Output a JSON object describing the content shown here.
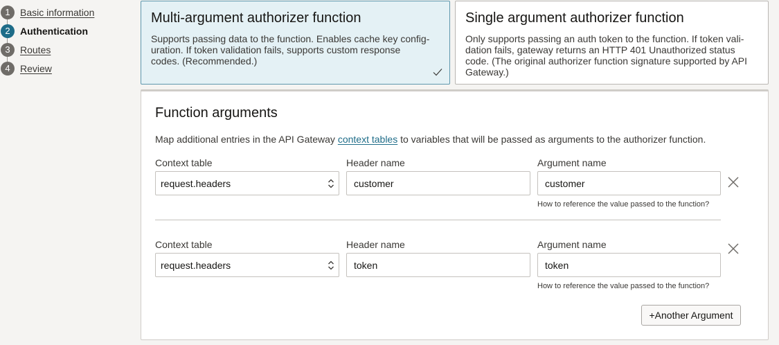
{
  "stepper": {
    "steps": [
      {
        "number": "1",
        "label": "Basic information",
        "active": false
      },
      {
        "number": "2",
        "label": "Authentication",
        "active": true
      },
      {
        "number": "3",
        "label": "Routes",
        "active": false
      },
      {
        "number": "4",
        "label": "Review",
        "active": false
      }
    ]
  },
  "cards": {
    "multi": {
      "title": "Multi-argument authorizer function",
      "desc_lines": [
        "Supports passing data to the function. Enables cache key config-",
        "uration. If token validation fails, supports custom response",
        "codes. (Recommended.)"
      ],
      "selected": true
    },
    "single": {
      "title": "Single argument authorizer function",
      "desc_lines": [
        "Only supports passing an auth token to the function. If token vali-",
        "dation fails, gateway returns an HTTP 401 Unauthorized status",
        "code. (The original authorizer function signature supported by API",
        "Gateway.)"
      ],
      "selected": false
    }
  },
  "function_arguments": {
    "title": "Function arguments",
    "intro_before": "Map additional entries in the API Gateway ",
    "intro_link": "context tables",
    "intro_after": " to variables that will be passed as arguments to the authorizer function.",
    "labels": {
      "context_table": "Context table",
      "header_name": "Header name",
      "argument_name": "Argument name"
    },
    "hint": "How to reference the value passed to the function?",
    "rows": [
      {
        "context_table": "request.headers",
        "header_name": "customer",
        "argument_name": "customer"
      },
      {
        "context_table": "request.headers",
        "header_name": "token",
        "argument_name": "token"
      }
    ],
    "add_button": "+Another Argument"
  },
  "colors": {
    "accent": "#1e6c88",
    "selected_card_bg": "#e4f1f5",
    "selected_card_border": "#5d97ad"
  },
  "icons": {
    "check": "check-icon",
    "remove": "close-icon",
    "select": "chevron-updown-icon"
  }
}
